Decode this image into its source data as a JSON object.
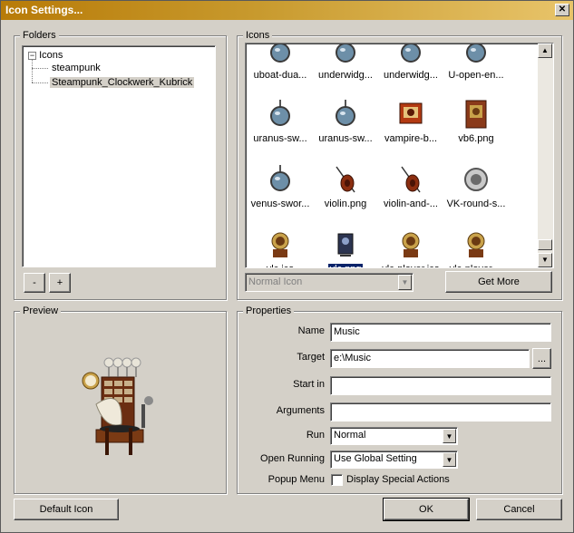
{
  "window": {
    "title": "Icon Settings...",
    "close_glyph": "✕"
  },
  "folders": {
    "label": "Folders",
    "tree": [
      {
        "label": "Icons",
        "expander": "−"
      },
      {
        "label": "steampunk"
      },
      {
        "label": "Steampunk_Clockwerk_Kubrick"
      }
    ],
    "remove_label": "-",
    "add_label": "+"
  },
  "icons": {
    "label": "Icons",
    "items": [
      {
        "label": "uboat-dua...",
        "icon": "steampunk-globe-icon"
      },
      {
        "label": "underwidg...",
        "icon": "steampunk-globe-icon"
      },
      {
        "label": "underwidg...",
        "icon": "steampunk-globe-icon"
      },
      {
        "label": "U-open-en...",
        "icon": "steampunk-globe-icon"
      },
      {
        "label": "uranus-sw...",
        "icon": "uranus-sword-icon"
      },
      {
        "label": "uranus-sw...",
        "icon": "uranus-sword-icon"
      },
      {
        "label": "vampire-b...",
        "icon": "vampire-book-icon"
      },
      {
        "label": "vb6.png",
        "icon": "vb6-icon"
      },
      {
        "label": "venus-swor...",
        "icon": "venus-sword-icon"
      },
      {
        "label": "violin.png",
        "icon": "violin-icon"
      },
      {
        "label": "violin-and-...",
        "icon": "violin-icon"
      },
      {
        "label": "VK-round-s...",
        "icon": "vk-round-icon"
      },
      {
        "label": "vlc.ico",
        "icon": "vlc-player-icon"
      },
      {
        "label": "vlc.png",
        "icon": "vlc-png-icon"
      },
      {
        "label": "vlc-player.ico",
        "icon": "vlc-player-icon"
      },
      {
        "label": "vlc-player....",
        "icon": "vlc-player-icon"
      }
    ],
    "selected_label": "vlc.png",
    "icon_type_value": "Normal Icon",
    "get_more_label": "Get More",
    "scroll_up": "▲",
    "scroll_down": "▼"
  },
  "preview": {
    "label": "Preview",
    "icon": "gramophone-cabinet-icon"
  },
  "properties": {
    "label": "Properties",
    "name_label": "Name",
    "name_value": "Music",
    "target_label": "Target",
    "target_value": "e:\\Music",
    "browse_label": "...",
    "startin_label": "Start in",
    "startin_value": "",
    "arguments_label": "Arguments",
    "arguments_value": "",
    "run_label": "Run",
    "run_value": "Normal",
    "openrunning_label": "Open Running",
    "openrunning_value": "Use Global Setting",
    "popup_label": "Popup Menu",
    "popup_checkbox_label": "Display Special Actions",
    "popup_checked": false
  },
  "footer": {
    "default_icon_label": "Default Icon",
    "ok_label": "OK",
    "cancel_label": "Cancel"
  },
  "dropdown_arrow": "▼"
}
